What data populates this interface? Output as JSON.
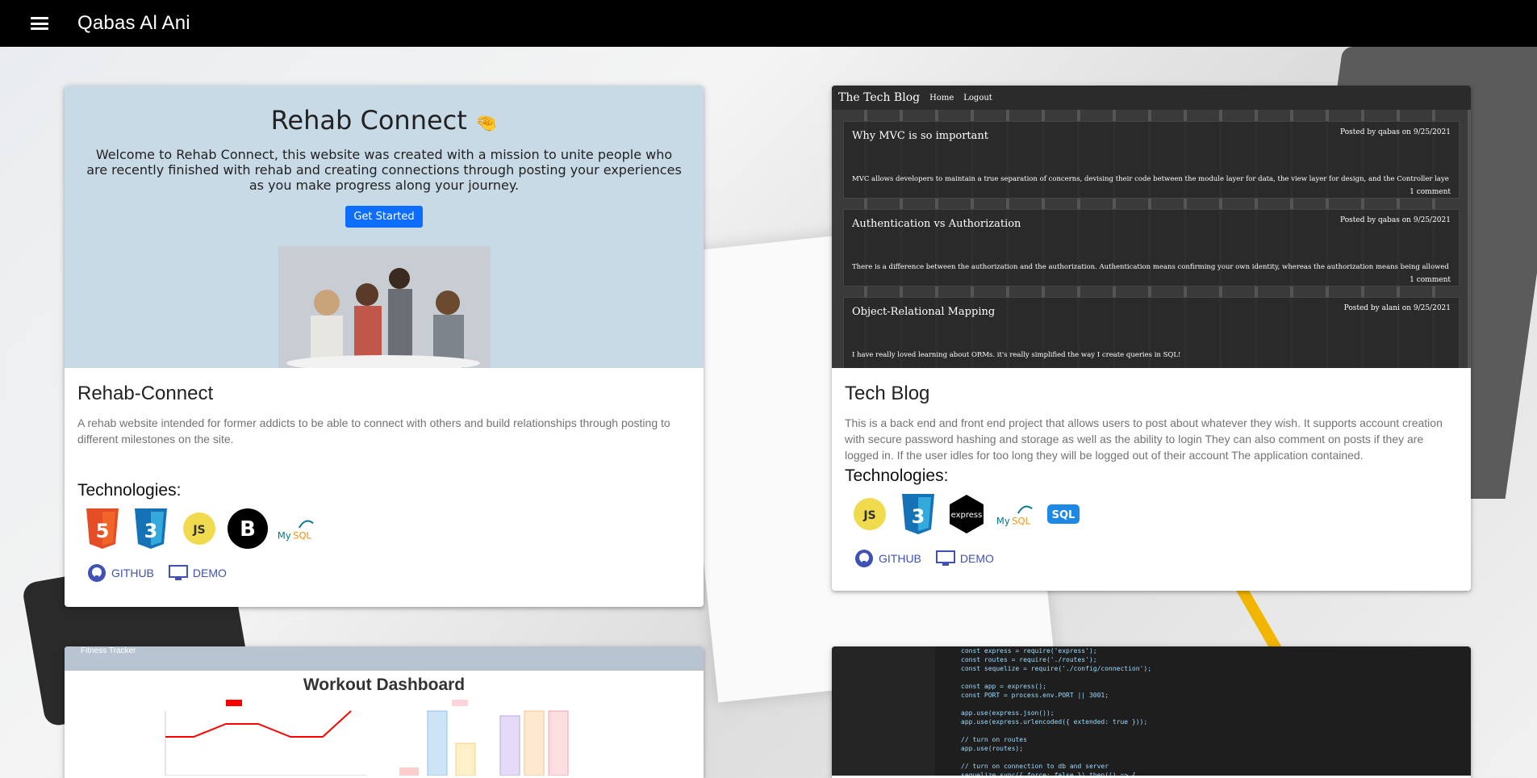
{
  "app": {
    "title": "Qabas Al Ani"
  },
  "projects": [
    {
      "title": "Rehab-Connect",
      "description": "A rehab website intended for former addicts to be able to connect with others and build relationships through posting to different milestones on the site.",
      "tech_heading": "Technologies:",
      "technologies": [
        "html5-icon",
        "css3-icon",
        "javascript-icon",
        "bootstrap-icon",
        "mysql-icon"
      ],
      "links": {
        "github": "GITHUB",
        "demo": "DEMO"
      },
      "preview": {
        "heading": "Rehab Connect",
        "text": "Welcome to Rehab Connect, this website was created with a mission to unite people who are recently finished with rehab and creating connections through posting your experiences as you make progress along your journey.",
        "button": "Get Started"
      }
    },
    {
      "title": "Tech Blog",
      "description": "This is a back end and front end project that allows users to post about whatever they wish. It supports account creation with secure password hashing and storage as well as the ability to login They can also comment on posts if they are logged in. If the user idles for too long they will be logged out of their account The application contained.",
      "tech_heading": "Technologies:",
      "technologies": [
        "javascript-icon",
        "css3-icon",
        "express-icon",
        "mysql-icon",
        "sql-icon"
      ],
      "links": {
        "github": "GITHUB",
        "demo": "DEMO"
      },
      "preview": {
        "brand": "The Tech Blog",
        "nav": [
          "Home",
          "Logout"
        ],
        "posts": [
          {
            "title": "Why MVC is so important",
            "meta": "Posted by qabas on 9/25/2021",
            "text": "MVC allows developers to maintain a true separation of concerns, devising their code between the module layer for data, the view layer for design, and the Controller layer for application logic.",
            "comments": "1 comment"
          },
          {
            "title": "Authentication vs Authorization",
            "meta": "Posted by qabas on 9/25/2021",
            "text": "There is a difference between the authorization and the authorization. Authentication means confirming your own identity, whereas the authorization means being allowed access to the system",
            "comments": "1 comment"
          },
          {
            "title": "Object-Relational Mapping",
            "meta": "Posted by alani on 9/25/2021",
            "text": "I have really loved learning about ORMs. it's really simplified the way I create queries in SQL!",
            "comments": ""
          }
        ]
      }
    },
    {
      "preview": {
        "bar": "Fitness Tracker",
        "heading": "Workout Dashboard"
      }
    },
    {
      "preview": {
        "code": "const express = require('express');\nconst routes = require('./routes');\nconst sequelize = require('./config/connection');\n\nconst app = express();\nconst PORT = process.env.PORT || 3001;\n\napp.use(express.json());\napp.use(express.urlencoded({ extended: true }));\n\n// turn on routes\napp.use(routes);\n\n// turn on connection to db and server\nsequelize.sync({ force: false }).then(() => {"
      }
    }
  ]
}
